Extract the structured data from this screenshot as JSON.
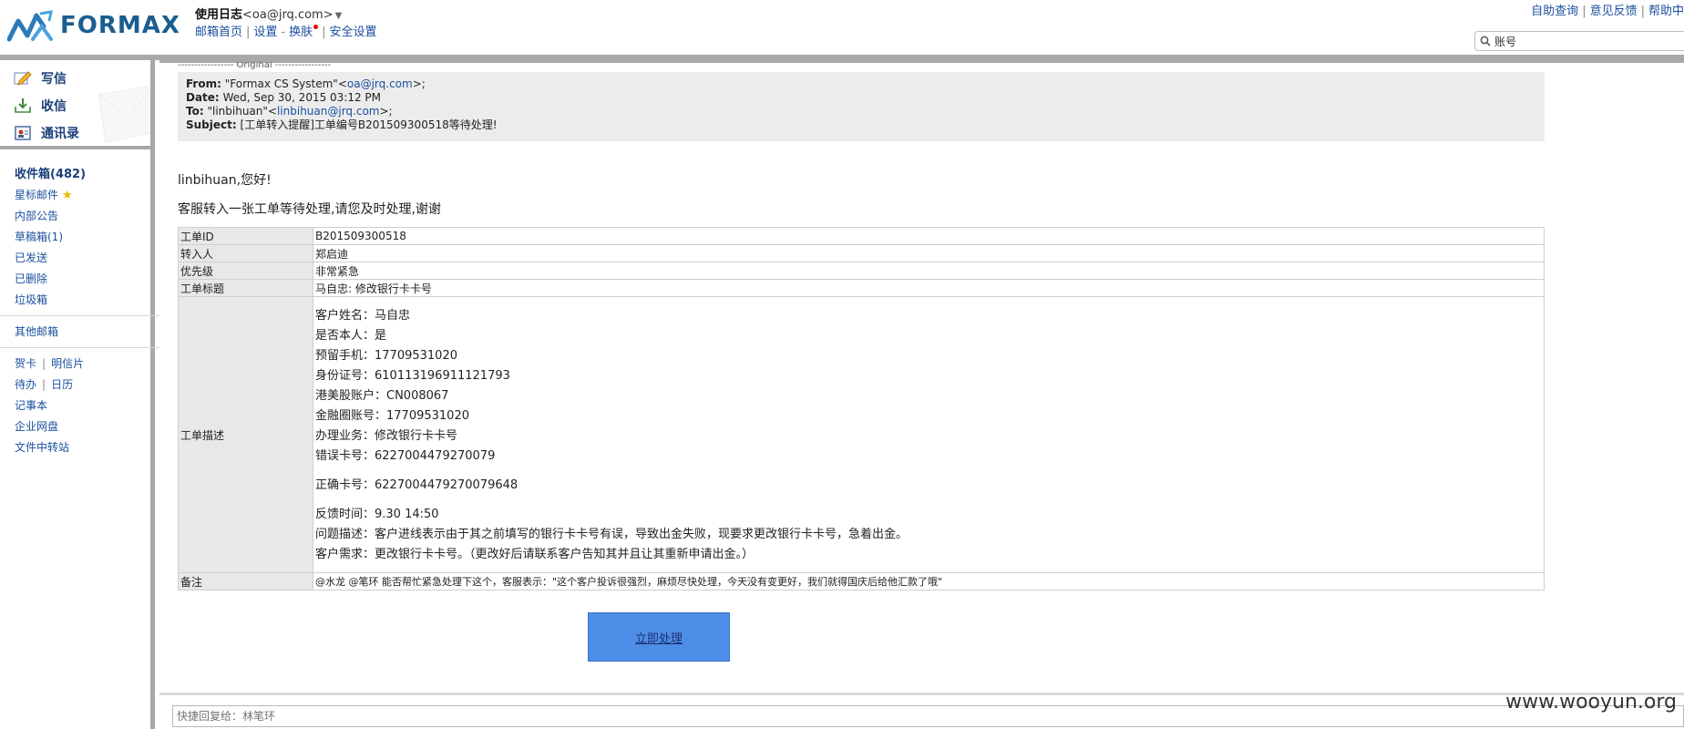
{
  "header": {
    "logo_text": "FORMAX",
    "user_name": "使用日志",
    "user_email": "<oa@jrq.com>",
    "dropdown_glyph": "▼",
    "links": [
      "邮箱首页",
      "设置",
      "换肤",
      "安全设置"
    ],
    "top_right_links": [
      "自助查询",
      "意见反馈",
      "帮助中"
    ],
    "search_value": "账号"
  },
  "sidebar": {
    "compose": [
      "写信",
      "收信",
      "通讯录"
    ],
    "folders": {
      "inbox": "收件箱(482)",
      "starred": "星标邮件",
      "notice": "内部公告",
      "drafts": "草稿箱(1)",
      "sent": "已发送",
      "deleted": "已删除",
      "trash": "垃圾箱",
      "other": "其他邮箱",
      "card": "贺卡",
      "postcard": "明信片",
      "todo": "待办",
      "calendar": "日历",
      "notes": "记事本",
      "netdisk": "企业网盘",
      "transfer": "文件中转站"
    },
    "separator": "|"
  },
  "mail": {
    "original_line": "----------------- Original -----------------",
    "from_label": "From:",
    "from_name": "\"Formax CS System\"<",
    "from_email": "oa@jrq.com",
    "from_tail": ">;",
    "date_label": "Date:",
    "date_value": "Wed, Sep 30, 2015 03:12 PM",
    "to_label": "To:",
    "to_name": "\"linbihuan\"<",
    "to_email": "linbihuan@jrq.com",
    "to_tail": ">;",
    "subject_label": "Subject:",
    "subject_value": "[工单转入提醒]工单编号B201509300518等待处理!",
    "greeting": "linbihuan,您好!",
    "intro": "客服转入一张工单等待处理,请您及时处理,谢谢"
  },
  "ticket": {
    "id_label": "工单ID",
    "id_value": "B201509300518",
    "transfer_label": "转入人",
    "transfer_value": "郑启迪",
    "priority_label": "优先级",
    "priority_value": "非常紧急",
    "title_label": "工单标题",
    "title_value": "马自忠: 修改银行卡卡号",
    "desc_label": "工单描述",
    "desc_lines": [
      "客户姓名：马自忠",
      "是否本人：是",
      "预留手机：17709531020",
      "身份证号：610113196911121793",
      "港美股账户：CN008067",
      "金融圈账号：17709531020",
      "办理业务：修改银行卡卡号",
      "错误卡号：6227004479270079"
    ],
    "desc_correct": "正确卡号：6227004479270079648",
    "desc_feedback_lines": [
      "反馈时间：9.30 14:50",
      "问题描述：客户进线表示由于其之前填写的银行卡卡号有误，导致出金失败，现要求更改银行卡卡号，急着出金。",
      "客户需求：更改银行卡卡号。（更改好后请联系客户告知其并且让其重新申请出金。）"
    ],
    "remark_label": "备注",
    "remark_value": "@水龙 @笔环 能否帮忙紧急处理下这个，客服表示：\"这个客户投诉很强烈，麻烦尽快处理，今天没有变更好，我们就得国庆后给他汇款了哦\""
  },
  "action_button": "立即处理",
  "quick_reply_placeholder": "快捷回复给：林笔环",
  "watermark": "www.wooyun.org",
  "colors": {
    "brand": "#1b5d8e",
    "link": "#1a4f9e",
    "button": "#4d8ee8",
    "frame_gray": "#a8a8a8"
  }
}
